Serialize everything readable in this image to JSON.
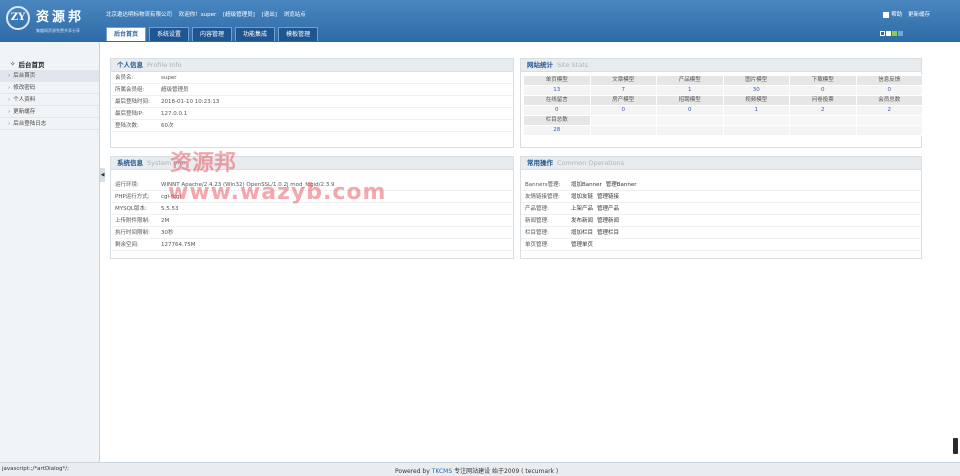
{
  "header": {
    "logo_mark": "ZY",
    "logo_name": "资源邦",
    "logo_slogan": "集趣网资源免费共享分享",
    "company": "北京遨达明标物流有限公司",
    "welcome": "欢迎你！super",
    "role": "[超级管理员]",
    "logout": "[退出]",
    "browse": "浏览站点",
    "help": "帮助",
    "refresh_cache": "更新缓存",
    "nav_tabs": [
      "后台首页",
      "系统设置",
      "内容管理",
      "功能集成",
      "模板管理"
    ],
    "squares": [
      "#2e6aa6",
      "#ffffff",
      "#8ccf4a",
      "#6aa9e0"
    ]
  },
  "sidebar": {
    "title": "后台首页",
    "items": [
      "后台首页",
      "修改密码",
      "个人资料",
      "更新缓存",
      "后台登陆日志"
    ]
  },
  "profile": {
    "title": "个人信息",
    "subtitle": "Profile Info",
    "rows": [
      {
        "k": "会员名:",
        "v": "super"
      },
      {
        "k": "所属会员组:",
        "v": "超级管理员"
      },
      {
        "k": "最后登陆时间:",
        "v": "2018-01-10 10:23:13"
      },
      {
        "k": "最后登陆IP:",
        "v": "127.0.0.1"
      },
      {
        "k": "登陆次数:",
        "v": "60次"
      }
    ]
  },
  "sysinfo": {
    "title": "系统信息",
    "subtitle": "System Info",
    "rows": [
      {
        "k": "运行环境:",
        "v": "WINNT Apache/2.4.23 (Win32) OpenSSL/1.0.2j mod_fcgid/2.3.9"
      },
      {
        "k": "PHP运行方式:",
        "v": "cgi-fcgi"
      },
      {
        "k": "MYSQL版本:",
        "v": "5.5.53"
      },
      {
        "k": "上传附件限制:",
        "v": "2M"
      },
      {
        "k": "执行时间限制:",
        "v": "30秒"
      },
      {
        "k": "剩余空间:",
        "v": "127764.75M"
      }
    ]
  },
  "stats": {
    "title": "网站统计",
    "subtitle": "Site Stats",
    "row1_labels": [
      "单页模型",
      "文章模型",
      "产品模型",
      "图片模型",
      "下载模型",
      "信息反馈"
    ],
    "row1_values": [
      "13",
      "7",
      "1",
      "30",
      "0",
      "0"
    ],
    "row2_labels": [
      "在线留言",
      "房产模型",
      "招聘模型",
      "视频模型",
      "问卷投票",
      "会员总数"
    ],
    "row2_values": [
      "0",
      "0",
      "0",
      "1",
      "2",
      "2"
    ],
    "row3_labels": [
      "栏目总数"
    ],
    "row3_values": [
      "28"
    ]
  },
  "common": {
    "title": "常用操作",
    "subtitle": "Common Operations",
    "rows": [
      {
        "k": "Banners管理:",
        "a": [
          "增加Banner",
          "管理Banner"
        ]
      },
      {
        "k": "友情链接管理:",
        "a": [
          "增加友链",
          "管理链接"
        ]
      },
      {
        "k": "产品管理:",
        "a": [
          "上架产品",
          "管理产品"
        ]
      },
      {
        "k": "新闻管理:",
        "a": [
          "发布新闻",
          "管理新闻"
        ]
      },
      {
        "k": "栏目管理:",
        "a": [
          "增加栏目",
          "管理栏目"
        ]
      },
      {
        "k": "单页管理:",
        "a": [
          "管理单页"
        ]
      }
    ]
  },
  "watermark": {
    "line1": "资源邦",
    "line2": "www.wazyb.com"
  },
  "status": {
    "js": "javascript:;/*artDialog*/;",
    "powered": "Powered by",
    "brand": "TKCMS",
    "tail": "专注网站建设 始于2009 ( tecumark )"
  }
}
